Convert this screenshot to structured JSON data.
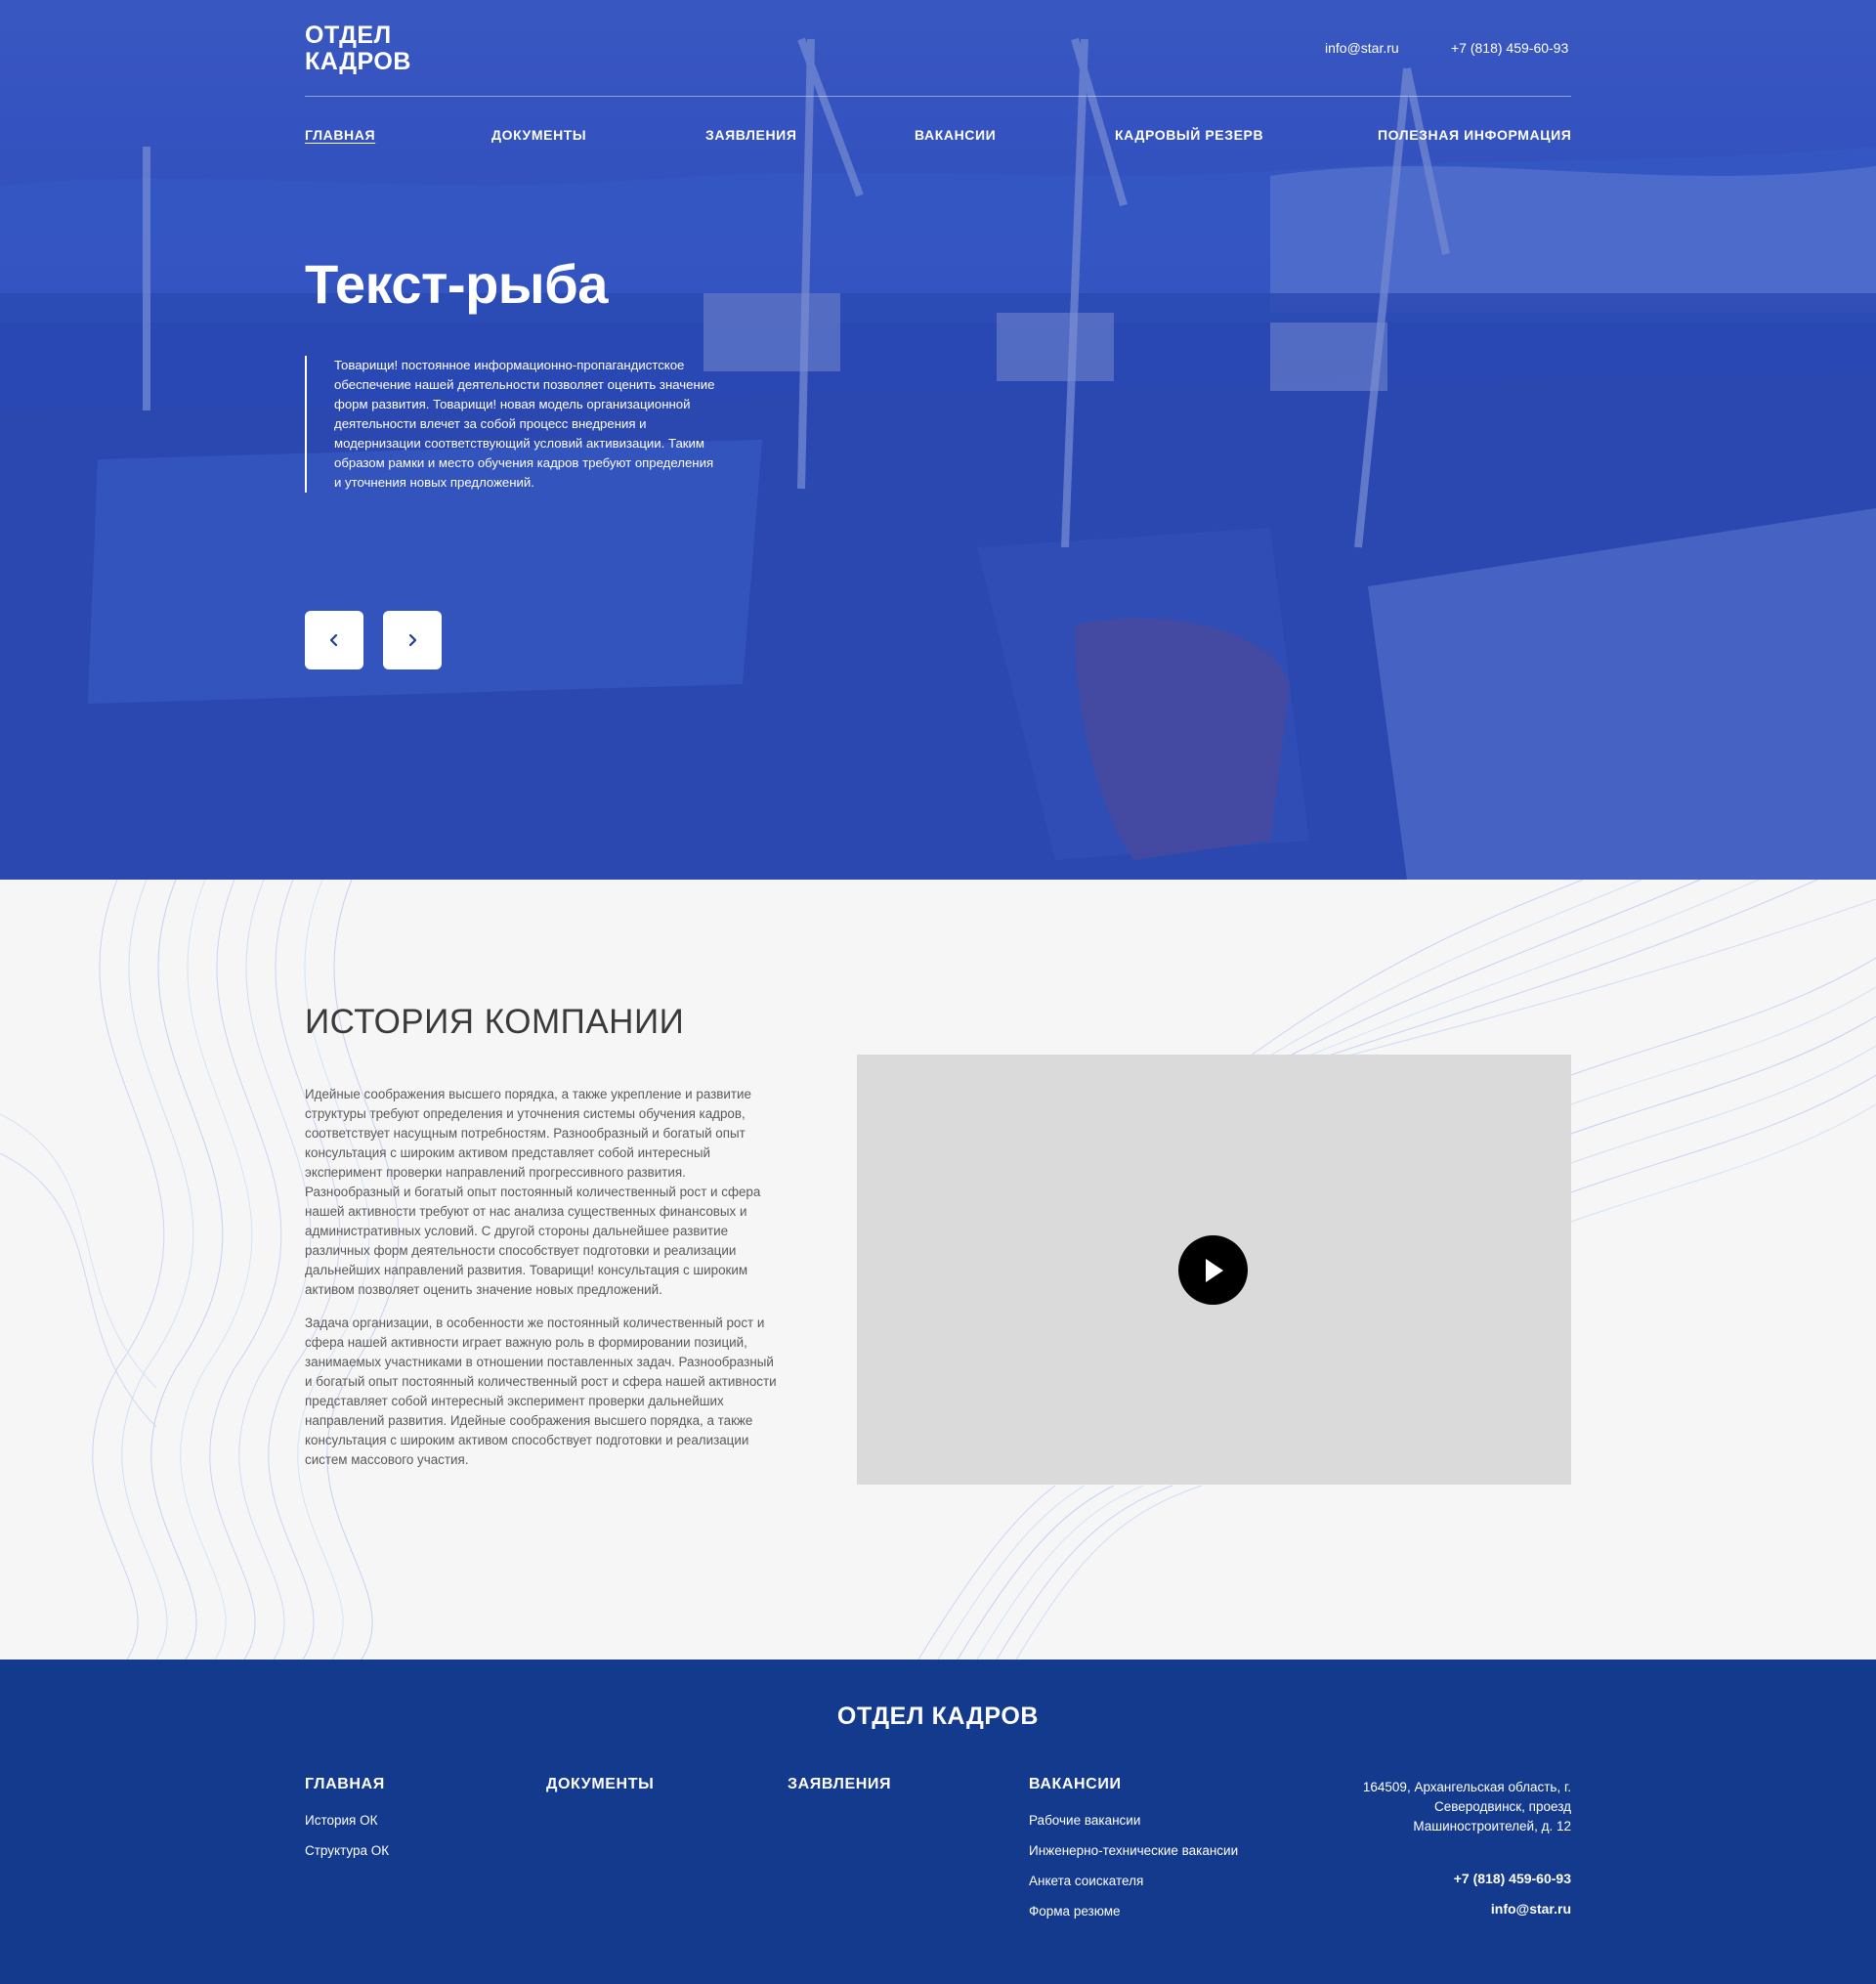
{
  "logo": {
    "line1": "ОТДЕЛ",
    "line2": "КАДРОВ"
  },
  "header": {
    "email": "info@star.ru",
    "phone": "+7 (818) 459-60-93"
  },
  "nav": [
    {
      "label": "ГЛАВНАЯ",
      "active": true
    },
    {
      "label": "ДОКУМЕНТЫ"
    },
    {
      "label": "ЗАЯВЛЕНИЯ"
    },
    {
      "label": "ВАКАНСИИ"
    },
    {
      "label": "КАДРОВЫЙ РЕЗЕРВ"
    },
    {
      "label": "ПОЛЕЗНАЯ ИНФОРМАЦИЯ"
    }
  ],
  "hero": {
    "title": "Текст-рыба",
    "quote": "Товарищи! постоянное информационно-пропагандистское обеспечение нашей деятельности позволяет оценить значение форм развития. Товарищи! новая модель организационной деятельности влечет за собой процесс внедрения и модернизации соответствующий условий активизации. Таким образом рамки и место обучения кадров требуют определения и уточнения новых предложений.",
    "prev_icon": "chevron-left-icon",
    "next_icon": "chevron-right-icon"
  },
  "history": {
    "title": "ИСТОРИЯ КОМПАНИИ",
    "paragraph1": "Идейные соображения высшего порядка, а также укрепление и развитие структуры требуют определения и уточнения системы обучения кадров, соответствует насущным потребностям. Разнообразный и богатый опыт консультация с широким активом представляет собой интересный эксперимент проверки направлений прогрессивного развития. Разнообразный и богатый опыт постоянный количественный рост и сфера нашей активности требуют от нас анализа существенных финансовых и административных условий. С другой стороны дальнейшее развитие различных форм деятельности способствует подготовки и реализации дальнейших направлений развития. Товарищи! консультация с широким активом позволяет оценить значение новых предложений.",
    "paragraph2": "Задача организации, в особенности же постоянный количественный рост и сфера нашей активности играет важную роль в формировании позиций, занимаемых участниками в отношении поставленных задач. Разнообразный и богатый опыт постоянный количественный рост и сфера нашей активности представляет собой интересный эксперимент проверки дальнейших направлений развития. Идейные соображения высшего порядка, а также консультация с широким активом способствует подготовки и реализации систем массового участия.",
    "video_icon": "play-icon"
  },
  "footer": {
    "title": "ОТДЕЛ КАДРОВ",
    "columns": [
      {
        "heading": "ГЛАВНАЯ",
        "links": [
          "История ОК",
          "Структура ОК"
        ]
      },
      {
        "heading": "ДОКУМЕНТЫ",
        "links": []
      },
      {
        "heading": "ЗАЯВЛЕНИЯ",
        "links": []
      },
      {
        "heading": "ВАКАНСИИ",
        "links": [
          "Рабочие вакансии",
          "Инженерно-технические вакансии",
          "Анкета соискателя",
          "Форма резюме"
        ]
      }
    ],
    "address": "164509, Архангельская область, г. Северодвинск, проезд Машиностроителей, д. 12",
    "phone": "+7 (818) 459-60-93",
    "email": "info@star.ru"
  },
  "colors": {
    "hero_blue": "#2f4db7",
    "footer_blue": "#133a8d",
    "video_placeholder": "#dadada"
  }
}
